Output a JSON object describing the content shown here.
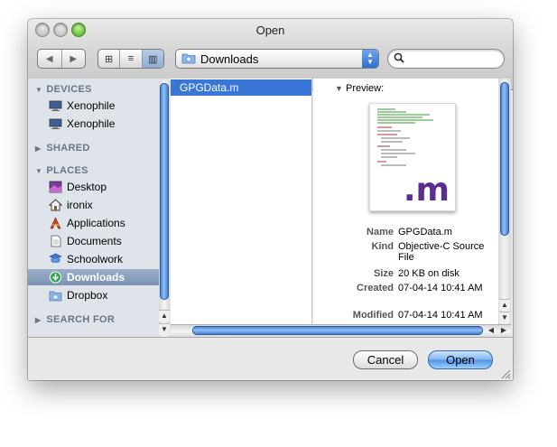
{
  "window": {
    "title": "Open"
  },
  "toolbar": {
    "back_glyph": "◀",
    "forward_glyph": "▶",
    "view_icons_glyph": "⊞",
    "view_list_glyph": "≡",
    "view_columns_glyph": "▥",
    "location": "Downloads",
    "search_placeholder": "",
    "popup_up": "▲",
    "popup_down": "▼"
  },
  "sidebar": {
    "devices_heading": "DEVICES",
    "shared_heading": "SHARED",
    "places_heading": "PLACES",
    "search_heading": "SEARCH FOR",
    "tri_open": "▼",
    "tri_closed": "▶",
    "devices": [
      {
        "label": "Xenophile",
        "icon": "display-icon"
      },
      {
        "label": "Xenophile",
        "icon": "display-icon"
      }
    ],
    "places": [
      {
        "label": "Desktop",
        "icon": "desktop-icon"
      },
      {
        "label": "ironix",
        "icon": "home-icon"
      },
      {
        "label": "Applications",
        "icon": "applications-icon"
      },
      {
        "label": "Documents",
        "icon": "documents-icon"
      },
      {
        "label": "Schoolwork",
        "icon": "folder-icon"
      },
      {
        "label": "Downloads",
        "icon": "downloads-icon"
      },
      {
        "label": "Dropbox",
        "icon": "folder-icon"
      }
    ],
    "selected": "Downloads"
  },
  "files": [
    {
      "name": "GPGData.m",
      "selected": true
    }
  ],
  "preview": {
    "heading": "Preview:",
    "thumbnail_ext": ".m",
    "fields": [
      {
        "key": "Name",
        "value": "GPGData.m"
      },
      {
        "key": "Kind",
        "value": "Objective-C Source File"
      },
      {
        "key": "Size",
        "value": "20 KB on disk"
      },
      {
        "key": "Created",
        "value": "07-04-14 10:41 AM"
      },
      {
        "key": "Modified",
        "value": "07-04-14 10:41 AM"
      }
    ]
  },
  "buttons": {
    "cancel": "Cancel",
    "open": "Open"
  },
  "colors": {
    "selection": "#3a76d8",
    "sidebar_bg": "#dee4ea",
    "scroll_thumb": "#4a82d6"
  }
}
